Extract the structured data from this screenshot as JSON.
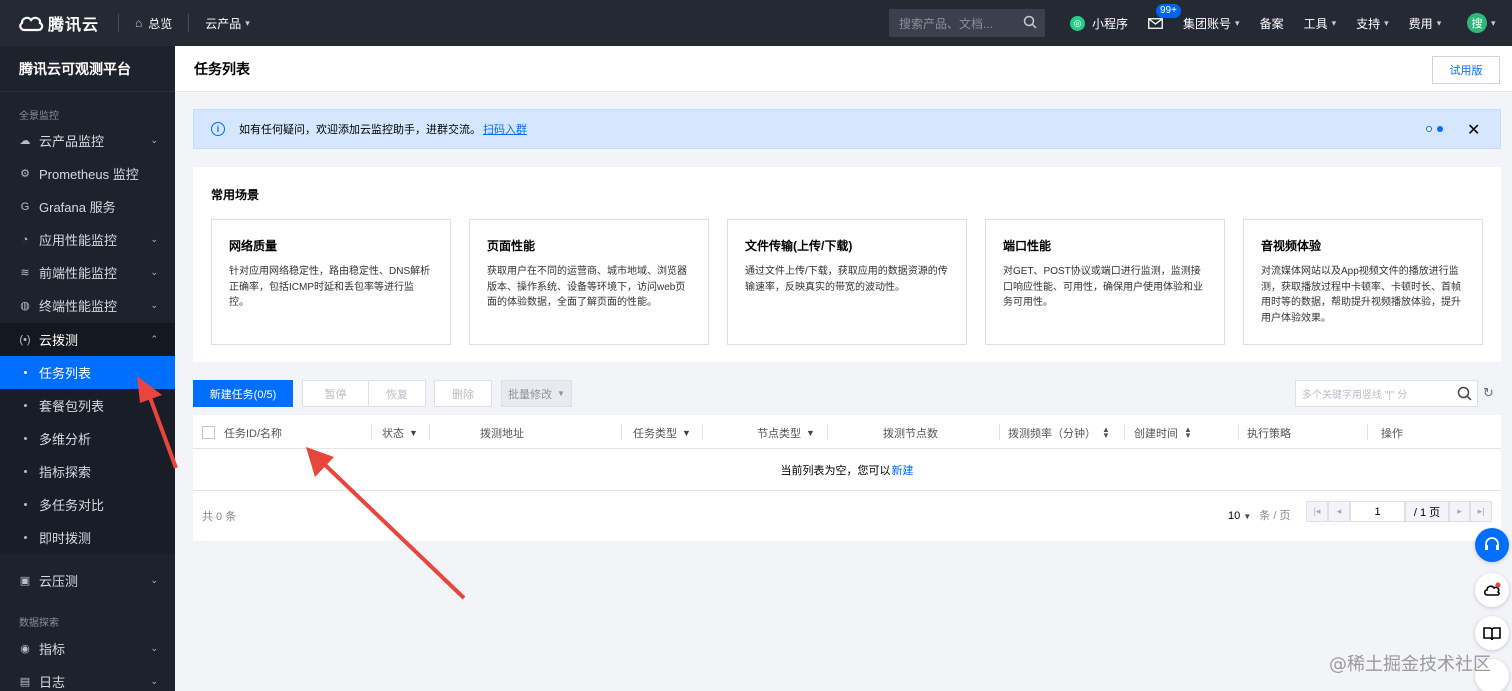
{
  "topbar": {
    "brand": "腾讯云",
    "overview": "总览",
    "products": "云产品",
    "search_placeholder": "搜索产品、文档...",
    "miniprogram": "小程序",
    "mail_badge": "99+",
    "group_account": "集团账号",
    "filing": "备案",
    "tools": "工具",
    "support": "支持",
    "billing": "费用",
    "avatar_text": "搜"
  },
  "sidebar": {
    "title": "腾讯云可观测平台",
    "group_panorama": "全景监控",
    "group_data": "数据探索",
    "items": [
      {
        "label": "云产品监控"
      },
      {
        "label": "Prometheus 监控"
      },
      {
        "label": "Grafana 服务"
      },
      {
        "label": "应用性能监控"
      },
      {
        "label": "前端性能监控"
      },
      {
        "label": "终端性能监控"
      },
      {
        "label": "云拨测"
      },
      {
        "label": "任务列表"
      },
      {
        "label": "套餐包列表"
      },
      {
        "label": "多维分析"
      },
      {
        "label": "指标探索"
      },
      {
        "label": "多任务对比"
      },
      {
        "label": "即时拨测"
      },
      {
        "label": "云压测"
      },
      {
        "label": "指标"
      },
      {
        "label": "日志"
      }
    ]
  },
  "main": {
    "title": "任务列表",
    "trial_button": "试用版",
    "notice": {
      "text": "如有任何疑问，欢迎添加云监控助手，进群交流。",
      "link": "扫码入群"
    },
    "scenes": {
      "title": "常用场景",
      "cards": [
        {
          "title": "网络质量",
          "desc": "针对应用网络稳定性，路由稳定性、DNS解析正确率，包括ICMP时延和丢包率等进行监控。"
        },
        {
          "title": "页面性能",
          "desc": "获取用户在不同的运营商、城市地域、浏览器版本、操作系统、设备等环境下，访问web页面的体验数据，全面了解页面的性能。"
        },
        {
          "title": "文件传输(上传/下载)",
          "desc": "通过文件上传/下载，获取应用的数据资源的传输速率，反映真实的带宽的波动性。"
        },
        {
          "title": "端口性能",
          "desc": "对GET、POST协议或端口进行监测，监测接口响应性能、可用性，确保用户使用体验和业务可用性。"
        },
        {
          "title": "音视频体验",
          "desc": "对流媒体网站以及App视频文件的播放进行监测，获取播放过程中卡顿率、卡顿时长、首帧用时等的数据，帮助提升视频播放体验，提升用户体验效果。"
        }
      ]
    },
    "toolbar": {
      "new_task": "新建任务(0/5)",
      "pause": "暂停",
      "resume": "恢复",
      "delete": "删除",
      "batch_edit": "批量修改",
      "search_placeholder": "多个关键字用竖线 \"|\" 分"
    },
    "table": {
      "columns": [
        "任务ID/名称",
        "状态",
        "拨测地址",
        "任务类型",
        "节点类型",
        "拨测节点数",
        "拨测频率（分钟）",
        "创建时间",
        "执行策略",
        "操作"
      ],
      "empty_text": "当前列表为空，您可以",
      "empty_link": "新建",
      "total": "共 0 条",
      "page_size": "10",
      "page_size_unit": "条 / 页",
      "current_page": "1",
      "total_pages": "/ 1 页"
    }
  },
  "watermark": "@稀土掘金技术社区",
  "colors": {
    "accent": "#006eff",
    "topbar": "#242933",
    "sidebar": "#1e222d",
    "annotation_arrow": "#e8453c"
  }
}
